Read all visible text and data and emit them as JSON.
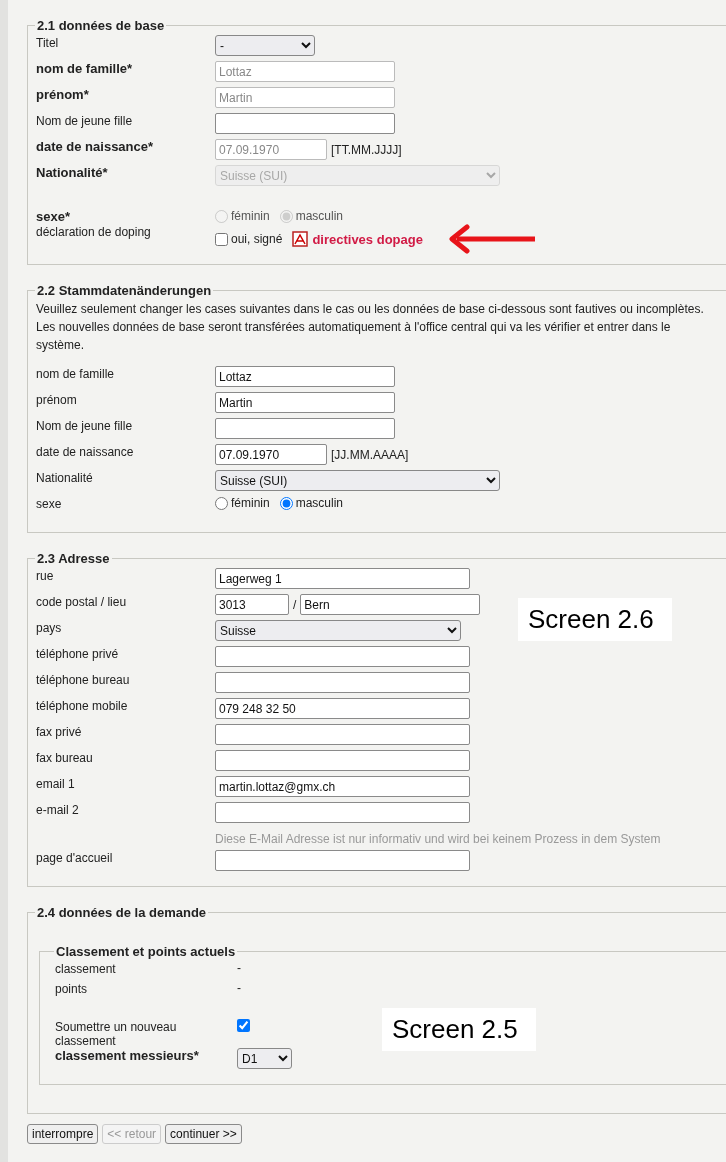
{
  "sections": [
    {
      "legend": "2.1 données de base",
      "rows": [
        {
          "kind": "smallselect",
          "label": "Titel",
          "required": false,
          "value": "-",
          "disabled": false
        },
        {
          "kind": "input",
          "label": "nom de famille*",
          "required": true,
          "value": "Lottaz",
          "disabled": true
        },
        {
          "kind": "input",
          "label": "prénom*",
          "required": true,
          "value": "Martin",
          "disabled": true
        },
        {
          "kind": "input",
          "label": "Nom de jeune fille",
          "required": false,
          "disabled": false
        },
        {
          "kind": "date",
          "label": "date de naissance*",
          "required": true,
          "value": "07.09.1970",
          "format": "[TT.MM.JJJJ]",
          "disabled": true
        },
        {
          "kind": "wideselect",
          "label": "Nationalité*",
          "required": true,
          "value": "Suisse (SUI)",
          "disabled": true
        },
        {
          "kind": "radio",
          "label": "sexe*",
          "required": true,
          "gap_before": true,
          "disabled": true,
          "options": [
            {
              "label": "féminin",
              "selected": false
            },
            {
              "label": "masculin",
              "selected": true
            }
          ]
        },
        {
          "kind": "checkbox",
          "label": "déclaration de doping",
          "required": false,
          "checked": false,
          "option_label": "oui, signé",
          "link": "directives dopage",
          "arrow": true
        }
      ]
    },
    {
      "legend": "2.2 Stammdatenänderungen",
      "intro": "Veuillez seulement changer les cases suivantes dans le cas ou les données de base ci-dessous sont fautives ou incomplètes. Les nouvelles données de base seront transférées automatiquement à l'office central qui va les vérifier et entrer dans le système.",
      "rows": [
        {
          "kind": "input",
          "label": "nom de famille",
          "required": false,
          "value": "Lottaz",
          "disabled": false
        },
        {
          "kind": "input",
          "label": "prénom",
          "required": false,
          "value": "Martin",
          "disabled": false
        },
        {
          "kind": "input",
          "label": "Nom de jeune fille",
          "required": false,
          "disabled": false
        },
        {
          "kind": "date",
          "label": "date de naissance",
          "required": false,
          "value": "07.09.1970",
          "format": "[JJ.MM.AAAA]",
          "disabled": false
        },
        {
          "kind": "wideselect",
          "label": "Nationalité",
          "required": false,
          "value": "Suisse (SUI)",
          "disabled": false
        },
        {
          "kind": "radio",
          "label": "sexe",
          "required": false,
          "disabled": false,
          "options": [
            {
              "label": "féminin",
              "selected": false
            },
            {
              "label": "masculin",
              "selected": true
            }
          ]
        }
      ]
    },
    {
      "legend": "2.3 Adresse",
      "annotation": "Screen 2.6",
      "rows": [
        {
          "kind": "longinput",
          "label": "rue",
          "required": false,
          "value": "Lagerweg 1",
          "disabled": false
        },
        {
          "kind": "postal",
          "label": "code postal / lieu",
          "required": false,
          "code": "3013",
          "separator": "/",
          "city": "Bern"
        },
        {
          "kind": "longselect",
          "label": "pays",
          "required": false,
          "value": "Suisse",
          "disabled": false
        },
        {
          "kind": "longinput",
          "label": "téléphone privé",
          "required": false,
          "disabled": false
        },
        {
          "kind": "longinput",
          "label": "téléphone bureau",
          "required": false,
          "disabled": false
        },
        {
          "kind": "longinput",
          "label": "téléphone mobile",
          "required": false,
          "value": "079 248 32 50",
          "disabled": false
        },
        {
          "kind": "longinput",
          "label": "fax privé",
          "required": false,
          "disabled": false
        },
        {
          "kind": "longinput",
          "label": "fax bureau",
          "required": false,
          "disabled": false
        },
        {
          "kind": "longinput",
          "label": "email 1",
          "required": false,
          "value": "martin.lottaz@gmx.ch",
          "disabled": false
        },
        {
          "kind": "longinput",
          "label": "e-mail 2",
          "required": false,
          "disabled": false,
          "hint": "Diese E-Mail Adresse ist nur informativ und wird bei keinem Prozess in dem System"
        },
        {
          "kind": "longinput",
          "label": "page d'accueil",
          "required": false,
          "disabled": false
        }
      ]
    },
    {
      "legend": "2.4 données de la demande",
      "annotation": "Screen 2.5",
      "subsection": {
        "legend": "Classement et points actuels",
        "rows": [
          {
            "kind": "static",
            "label": "classement",
            "required": false,
            "value": "-"
          },
          {
            "kind": "static",
            "label": "points",
            "required": false,
            "value": "-"
          },
          {
            "kind": "checkbox",
            "label": "Soumettre un nouveau classement",
            "required": false,
            "gap_before": true,
            "checked": true
          },
          {
            "kind": "tinyselect",
            "label": "classement messieurs*",
            "required": true,
            "value": "D1",
            "disabled": false
          }
        ]
      }
    }
  ],
  "buttons": [
    {
      "label": "interrompre",
      "disabled": false
    },
    {
      "label": "<< retour",
      "disabled": true
    },
    {
      "label": "continuer >>",
      "disabled": false
    }
  ]
}
